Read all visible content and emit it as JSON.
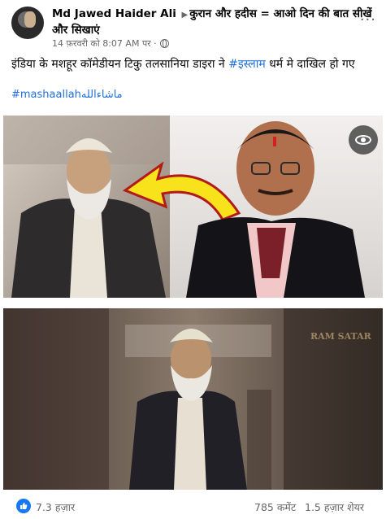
{
  "post": {
    "author": "Md Jawed Haider Ali",
    "group": "कुरान और हदीस = आओ दिन की बात सीखें और सिखाएं",
    "timestamp": "14 फ़रवरी को 8:07 AM पर ·",
    "text_before": "इंडिया के मशहूर कॉमेडीयन टिकु तलसानिया डाइरा ने ",
    "text_hashtag": "#इस्लाम",
    "text_after": " धर्म मे दाखिल हो गए",
    "tag": "#mashaallahماشاءالله",
    "watermark": "RAM SATAR"
  },
  "footer": {
    "likes": "7.3 हज़ार",
    "comments": "785 कमेंट",
    "shares": "1.5 हज़ार शेयर"
  },
  "colors": {
    "link": "#216fdb",
    "like_blue": "#1877f2",
    "arrow": "#f7e21c"
  }
}
